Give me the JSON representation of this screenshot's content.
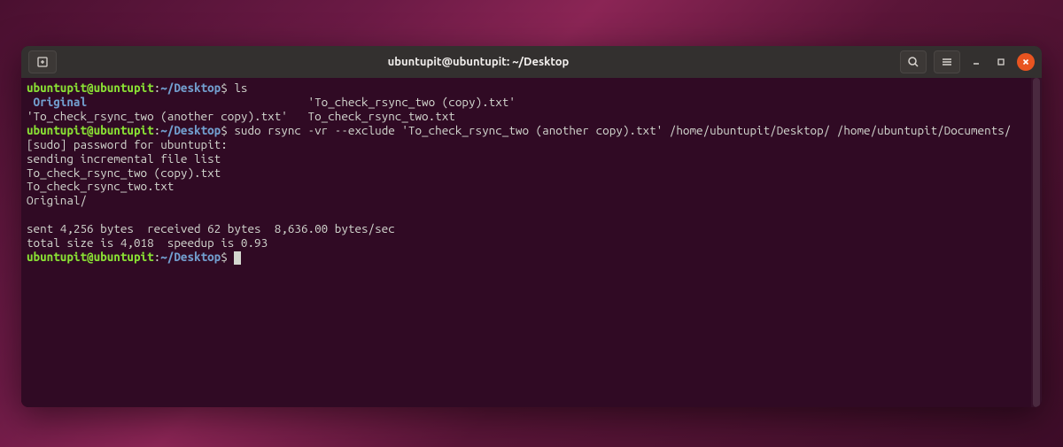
{
  "window": {
    "title": "ubuntupit@ubuntupit: ~/Desktop"
  },
  "prompt": {
    "user_host": "ubuntupit@ubuntupit",
    "sep": ":",
    "path": "~/Desktop",
    "dollar": "$"
  },
  "lines": {
    "l0_cmd": " ls",
    "l1a": " Original",
    "l1b": "                                 'To_check_rsync_two (copy).txt'",
    "l2": "'To_check_rsync_two (another copy).txt'   To_check_rsync_two.txt",
    "l3_cmd": " sudo rsync -vr --exclude 'To_check_rsync_two (another copy).txt' /home/ubuntupit/Desktop/ /home/ubuntupit/Documents/",
    "l4": "[sudo] password for ubuntupit:",
    "l5": "sending incremental file list",
    "l6": "To_check_rsync_two (copy).txt",
    "l7": "To_check_rsync_two.txt",
    "l8": "Original/",
    "l9": "",
    "l10": "sent 4,256 bytes  received 62 bytes  8,636.00 bytes/sec",
    "l11": "total size is 4,018  speedup is 0.93"
  }
}
